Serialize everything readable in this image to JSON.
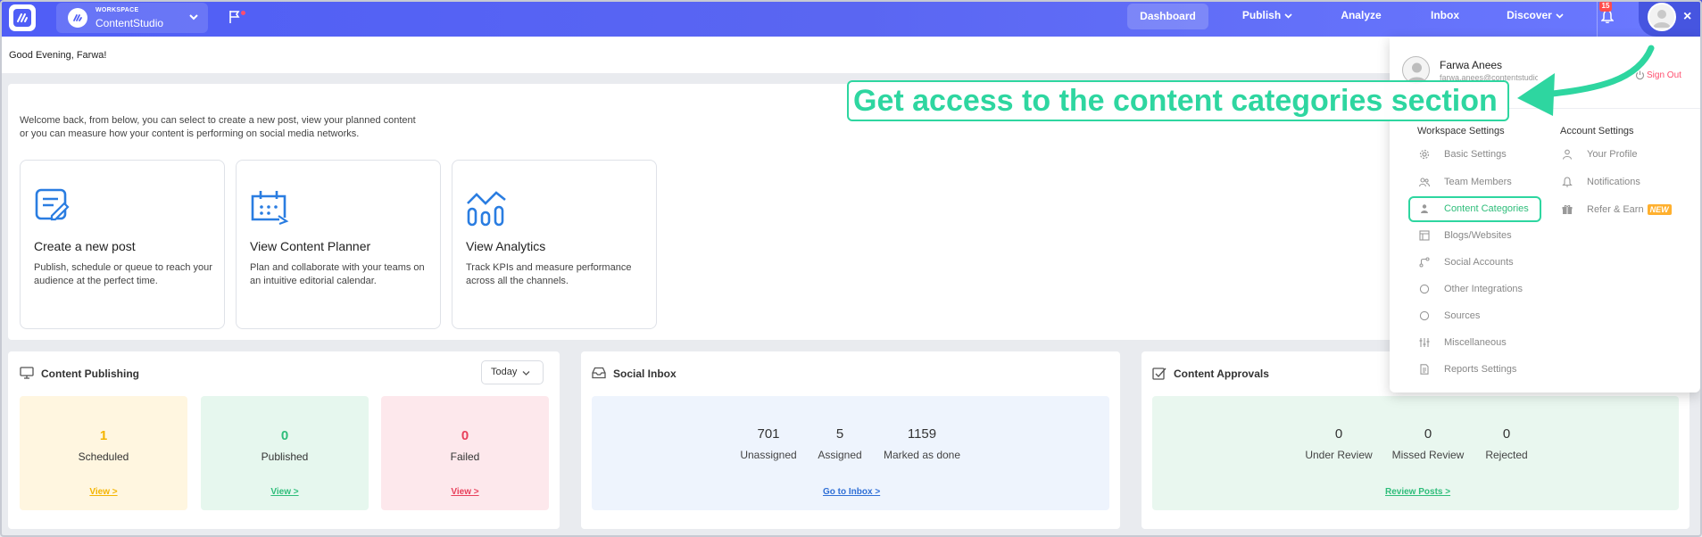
{
  "topbar": {
    "workspace_label": "WORKSPACE",
    "workspace_name": "ContentStudio",
    "nav": {
      "dashboard": "Dashboard",
      "publish": "Publish",
      "analyze": "Analyze",
      "inbox": "Inbox",
      "discover": "Discover"
    },
    "notification_count": "15",
    "close": "×"
  },
  "greeting": "Good Evening, Farwa!",
  "welcome": {
    "text": "Welcome back, from below, you can select to create a new post, view your planned content or you can measure how your content is performing on social media networks.",
    "cards": [
      {
        "title": "Create a new post",
        "desc": "Publish, schedule or queue to reach your audience at the perfect time."
      },
      {
        "title": "View Content Planner",
        "desc": "Plan and collaborate with your teams on an intuitive editorial calendar."
      },
      {
        "title": "View Analytics",
        "desc": "Track KPIs and measure performance across all the channels."
      }
    ]
  },
  "publishing": {
    "title": "Content Publishing",
    "filter": "Today",
    "stats": [
      {
        "value": "1",
        "label": "Scheduled",
        "link": "View >"
      },
      {
        "value": "0",
        "label": "Published",
        "link": "View >"
      },
      {
        "value": "0",
        "label": "Failed",
        "link": "View >"
      }
    ]
  },
  "inbox": {
    "title": "Social Inbox",
    "metrics": [
      {
        "value": "701",
        "label": "Unassigned"
      },
      {
        "value": "5",
        "label": "Assigned"
      },
      {
        "value": "1159",
        "label": "Marked as done"
      }
    ],
    "link": "Go to Inbox >"
  },
  "approvals": {
    "title": "Content Approvals",
    "metrics": [
      {
        "value": "0",
        "label": "Under Review"
      },
      {
        "value": "0",
        "label": "Missed Review"
      },
      {
        "value": "0",
        "label": "Rejected"
      }
    ],
    "link": "Review Posts >"
  },
  "dropdown": {
    "name": "Farwa Anees",
    "email": "farwa.anees@contentstudio",
    "sign_out": "Sign Out",
    "workspace_heading": "Workspace Settings",
    "account_heading": "Account Settings",
    "workspace_items": [
      "Basic Settings",
      "Team Members",
      "Content Categories",
      "Blogs/Websites",
      "Social Accounts",
      "Other Integrations",
      "Sources",
      "Miscellaneous",
      "Reports Settings"
    ],
    "account_items": [
      "Your Profile",
      "Notifications",
      "Refer & Earn"
    ],
    "new_badge": "NEW"
  },
  "annotation": {
    "text": "Get access to the content categories section",
    "color": "#2ed6a0"
  },
  "colors": {
    "brand": "#5663f5",
    "scheduled": "#f4b400",
    "published": "#2ebd7a",
    "failed": "#e8405b",
    "inbox_link": "#2f6fd6",
    "approval_link": "#2ebd7a"
  }
}
